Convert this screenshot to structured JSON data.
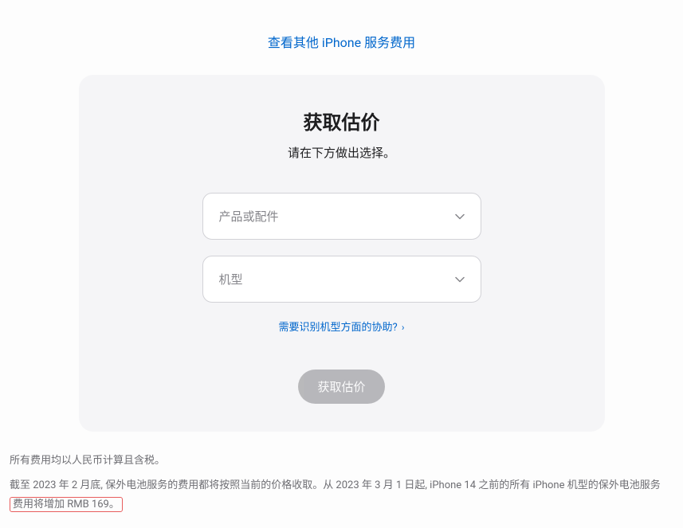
{
  "topLink": {
    "label": "查看其他 iPhone 服务费用"
  },
  "card": {
    "title": "获取估价",
    "subtitle": "请在下方做出选择。",
    "select1": {
      "placeholder": "产品或配件"
    },
    "select2": {
      "placeholder": "机型"
    },
    "helpLink": "需要识别机型方面的协助?",
    "submit": "获取估价"
  },
  "footer": {
    "line1": "所有费用均以人民币计算且含税。",
    "line2_part1": "截至 2023 年 2 月底, 保外电池服务的费用都将按照当前的价格收取。从 2023 年 3 月 1 日起, iPhone 14 之前的所有 iPhone 机型的保外电池服务",
    "line2_highlight": "费用将增加 RMB 169。"
  }
}
